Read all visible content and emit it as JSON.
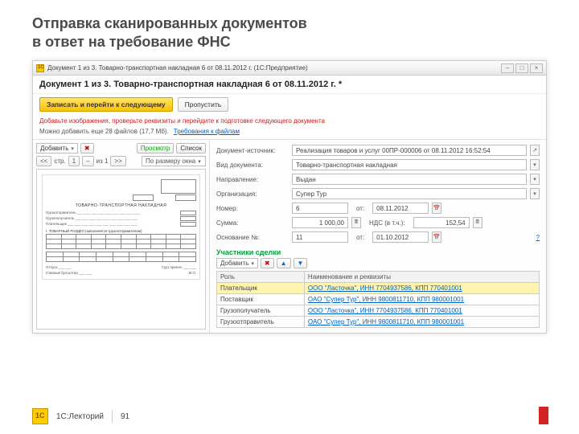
{
  "slide_title_l1": "Отправка сканированных документов",
  "slide_title_l2": "в ответ на требование ФНС",
  "titlebar": "Документ 1 из 3. Товарно-транспортная накладная 6 от 08.11.2012 г.  (1С:Предприятие)",
  "doc_title": "Документ 1 из 3. Товарно-транспортная накладная 6 от 08.11.2012 г. *",
  "btn_save_next": "Записать и перейти к следующему",
  "btn_skip": "Пропустить",
  "hint": "Добавьте изображения, проверьте реквизиты и перейдите к подготовке следующего документа",
  "files_left": "Можно добавить еще 28 файлов (17,7 Мб).",
  "link_req": "Требования к файлам",
  "left_add": "Добавить",
  "left_view": "Просмотр",
  "left_list": "Список",
  "pg_label": "стр.",
  "pg_cur": "1",
  "pg_of": "из 1",
  "zoom": "По размеру окна",
  "fields": {
    "source_l": "Документ-источник:",
    "source_v": "Реализация товаров и услуг 00ПР-000006 от 08.11.2012 16:52:54",
    "type_l": "Вид документа:",
    "type_v": "Товарно-транспортная накладная",
    "dir_l": "Направление:",
    "dir_v": "Выдан",
    "org_l": "Организация:",
    "org_v": "Супер Тур",
    "num_l": "Номер:",
    "num_v": "6",
    "date_l": "от:",
    "date_v": "08.11.2012",
    "sum_l": "Сумма:",
    "sum_v": "1 000,00",
    "vat_l": "НДС (в т.ч.):",
    "vat_v": "152,54",
    "base_l": "Основание №:",
    "base_v": "11",
    "base_date_l": "от:",
    "base_date_v": "01.10.2012"
  },
  "section_parties": "Участники сделки",
  "party_add": "Добавить",
  "tbl_role": "Роль",
  "tbl_details": "Наименование и реквизиты",
  "parties": [
    {
      "role": "Плательщик",
      "det": "ООО \"Ласточка\", ИНН 7704937586, КПП 770401001"
    },
    {
      "role": "Поставщик",
      "det": "ОАО \"Супер Тур\", ИНН 9800811710, КПП 980001001"
    },
    {
      "role": "Грузополучатель",
      "det": "ООО \"Ласточка\", ИНН 7704937586, КПП 770401001"
    },
    {
      "role": "Грузоотправитель",
      "det": "ОАО \"Супер Тур\", ИНН 9800811710, КПП 980001001"
    }
  ],
  "footer_brand": "1С:Лекторий",
  "footer_page": "91",
  "win_min": "–",
  "win_max": "□",
  "win_close": "×",
  "doc_preview": {
    "title": "ТОВАРНО-ТРАНСПОРТНАЯ НАКЛАДНАЯ",
    "section": "І. ТОВАРНЫЙ РАЗДЕЛ (заполняется грузоотправителем)"
  }
}
